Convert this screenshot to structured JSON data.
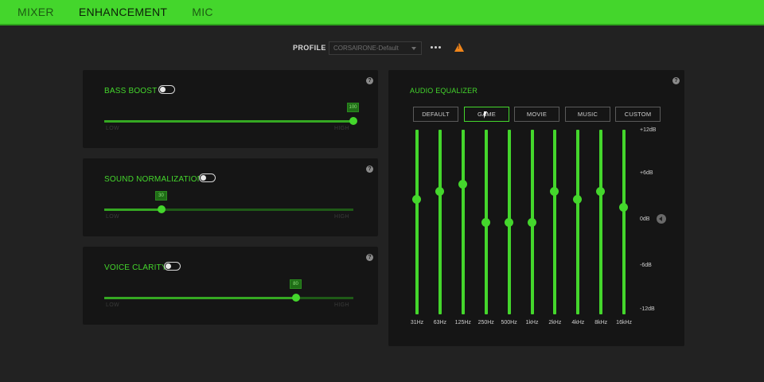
{
  "tabs": [
    {
      "label": "MIXER",
      "active": false
    },
    {
      "label": "ENHANCEMENT",
      "active": true
    },
    {
      "label": "MIC",
      "active": false
    }
  ],
  "profile": {
    "label": "PROFILE",
    "selected": "CORSAIRONE-Default"
  },
  "enhancements": [
    {
      "title": "BASS BOOST",
      "enabled": false,
      "value": "100",
      "level": 1.0,
      "low": "LOW",
      "high": "HIGH"
    },
    {
      "title": "SOUND NORMALIZATION",
      "enabled": false,
      "value": "30",
      "level": 0.23,
      "low": "LOW",
      "high": "HIGH"
    },
    {
      "title": "VOICE CLARITY",
      "enabled": false,
      "value": "80",
      "level": 0.77,
      "low": "LOW",
      "high": "HIGH"
    }
  ],
  "equalizer": {
    "title": "AUDIO EQUALIZER",
    "presets": [
      {
        "label": "DEFAULT",
        "active": false
      },
      {
        "label": "GAME",
        "active": true
      },
      {
        "label": "MOVIE",
        "active": false
      },
      {
        "label": "MUSIC",
        "active": false
      },
      {
        "label": "CUSTOM",
        "active": false
      }
    ],
    "db_labels": [
      "+12dB",
      "+6dB",
      "0dB",
      "-6dB",
      "-12dB"
    ],
    "bands": [
      {
        "freq": "31Hz",
        "db": 3
      },
      {
        "freq": "63Hz",
        "db": 4
      },
      {
        "freq": "125Hz",
        "db": 5
      },
      {
        "freq": "250Hz",
        "db": 0
      },
      {
        "freq": "500Hz",
        "db": 0
      },
      {
        "freq": "1kHz",
        "db": 0
      },
      {
        "freq": "2kHz",
        "db": 4
      },
      {
        "freq": "4kHz",
        "db": 3
      },
      {
        "freq": "8kHz",
        "db": 4
      },
      {
        "freq": "16kHz",
        "db": 2
      }
    ]
  },
  "colors": {
    "accent": "#44d62c",
    "warning": "#f0851a",
    "background": "#222222",
    "panel": "#151515"
  }
}
